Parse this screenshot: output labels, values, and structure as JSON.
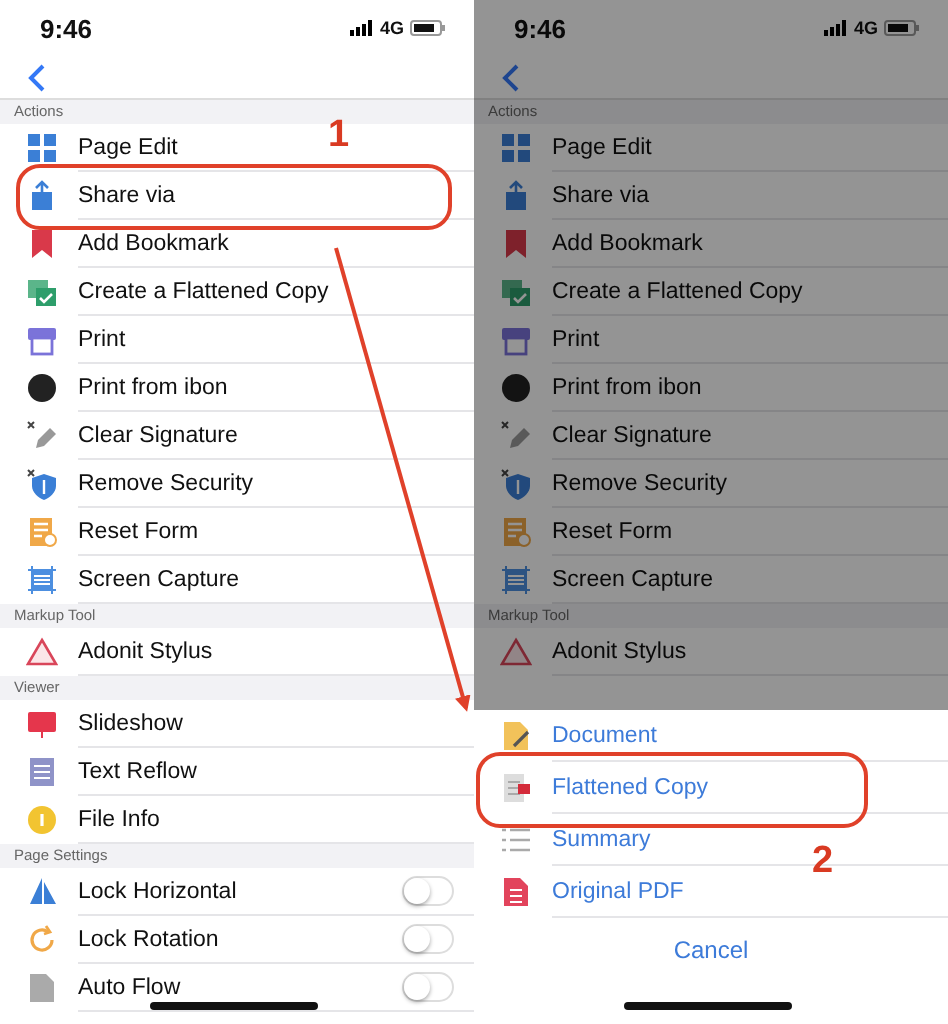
{
  "panels": [
    {
      "status_bar": {
        "time": "9:46",
        "network": "4G"
      },
      "dimmed": false,
      "sections": [
        {
          "title": "Actions",
          "items": [
            {
              "label": "Page Edit"
            },
            {
              "label": "Share via"
            },
            {
              "label": "Add Bookmark"
            },
            {
              "label": "Create a Flattened Copy"
            },
            {
              "label": "Print"
            },
            {
              "label": "Print from ibon"
            },
            {
              "label": "Clear Signature"
            },
            {
              "label": "Remove Security"
            },
            {
              "label": "Reset Form"
            },
            {
              "label": "Screen Capture"
            }
          ]
        },
        {
          "title": "Markup Tool",
          "items": [
            {
              "label": "Adonit Stylus"
            }
          ]
        },
        {
          "title": "Viewer",
          "items": [
            {
              "label": "Slideshow"
            },
            {
              "label": "Text Reflow"
            },
            {
              "label": "File Info"
            }
          ]
        },
        {
          "title": "Page Settings",
          "items": [
            {
              "label": "Lock Horizontal",
              "kind": "toggle",
              "on": false
            },
            {
              "label": "Lock Rotation",
              "kind": "toggle",
              "on": false
            },
            {
              "label": "Auto Flow",
              "kind": "toggle",
              "on": false
            }
          ]
        }
      ]
    },
    {
      "status_bar": {
        "time": "9:46",
        "network": "4G"
      },
      "dimmed": true,
      "sections": [
        {
          "title": "Actions",
          "items": [
            {
              "label": "Page Edit"
            },
            {
              "label": "Share via"
            },
            {
              "label": "Add Bookmark"
            },
            {
              "label": "Create a Flattened Copy"
            },
            {
              "label": "Print"
            },
            {
              "label": "Print from ibon"
            },
            {
              "label": "Clear Signature"
            },
            {
              "label": "Remove Security"
            },
            {
              "label": "Reset Form"
            },
            {
              "label": "Screen Capture"
            }
          ]
        },
        {
          "title": "Markup Tool",
          "items": [
            {
              "label": "Adonit Stylus"
            }
          ]
        }
      ],
      "sheet": {
        "items": [
          {
            "label": "Document"
          },
          {
            "label": "Flattened Copy"
          },
          {
            "label": "Summary"
          },
          {
            "label": "Original PDF"
          }
        ],
        "cancel": "Cancel"
      }
    }
  ],
  "annotations": [
    {
      "label": "1"
    },
    {
      "label": "2"
    }
  ]
}
